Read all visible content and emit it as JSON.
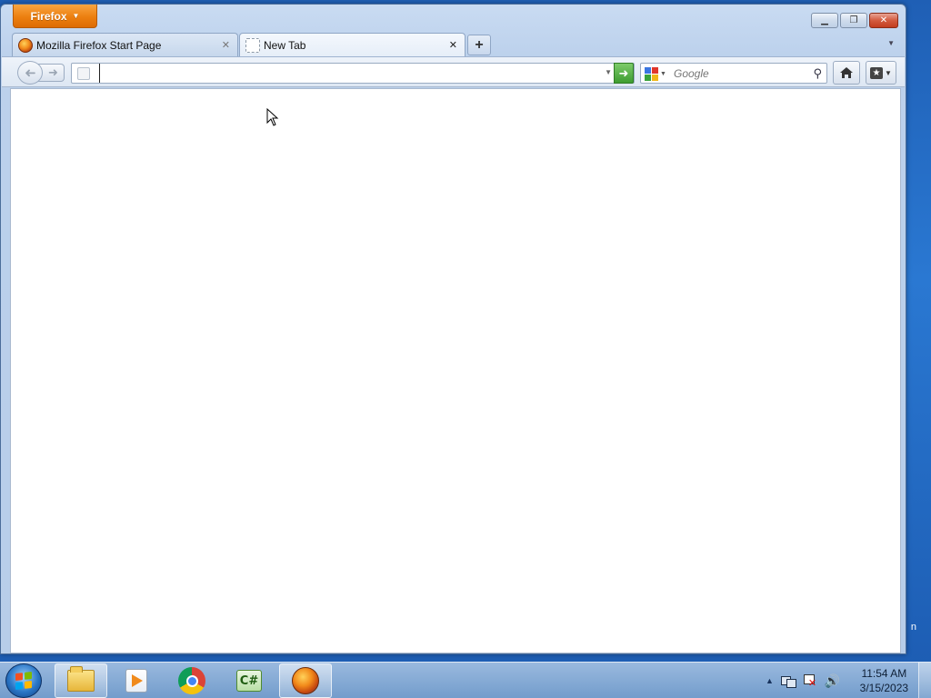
{
  "desktop": {
    "edge_text": "n"
  },
  "window": {
    "app_menu_label": "Firefox",
    "controls": {
      "minimize": "minimize",
      "maximize": "maximize",
      "close": "close"
    }
  },
  "tabs": [
    {
      "title": "Mozilla Firefox Start Page",
      "favicon": "firefox-icon",
      "active": false
    },
    {
      "title": "New Tab",
      "favicon": "blank-page-icon",
      "active": true
    }
  ],
  "new_tab_label": "+",
  "navbar": {
    "url_value": "",
    "search_placeholder": "Google",
    "search_engine": "google-icon"
  },
  "taskbar": {
    "items": [
      {
        "name": "Windows Explorer",
        "icon": "folder-icon",
        "active": true
      },
      {
        "name": "Windows Media Player",
        "icon": "media-player-icon",
        "active": false
      },
      {
        "name": "Google Chrome",
        "icon": "chrome-icon",
        "active": false
      },
      {
        "name": "C# Editor",
        "icon": "csharp-icon",
        "active": false,
        "label": "C#"
      },
      {
        "name": "Firefox",
        "icon": "firefox-icon",
        "active": true
      }
    ],
    "clock": {
      "time": "11:54 AM",
      "date": "3/15/2023"
    }
  },
  "colors": {
    "firefox_orange": "#ec7f10",
    "go_green": "#3e9c31",
    "desktop_blue": "#2a78d2"
  }
}
